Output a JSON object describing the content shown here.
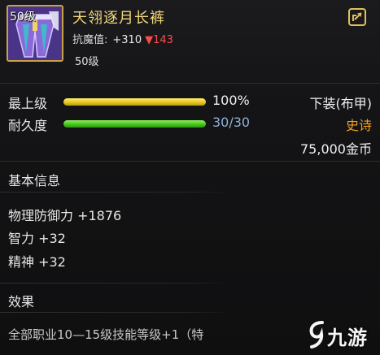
{
  "item": {
    "level_tag": "50级",
    "name": "天翎逐月长裤",
    "resist_label": "抗魔值:",
    "resist_plus": "+310",
    "resist_minus": "▼143",
    "required_level": "50级"
  },
  "stats": {
    "grade_label": "最上级",
    "grade_value": "100%",
    "grade_fill": 1.0,
    "durability_label": "耐久度",
    "durability_value": "30/30",
    "durability_fill": 1.0,
    "slot_type": "下装(布甲)",
    "rarity": "史诗",
    "price": "75,000金币"
  },
  "basic_info": {
    "title": "基本信息",
    "lines": [
      "物理防御力 +1876",
      "智力 +32",
      "精神 +32"
    ]
  },
  "effect": {
    "title": "效果",
    "text": "全部职业10—15级技能等级+1（特"
  },
  "watermark": {
    "text": "九游"
  },
  "icons": {
    "share": "share-icon",
    "item": "leggings-icon",
    "logo": "jiuyou-logo-icon"
  },
  "colors": {
    "name_gold": "#f1d97a",
    "rarity_orange": "#f0a020",
    "resist_red": "#ff4a4a",
    "bar_yellow": "#e3c21d",
    "bar_green": "#42c21c",
    "durability_blue": "#8fb0d6"
  }
}
